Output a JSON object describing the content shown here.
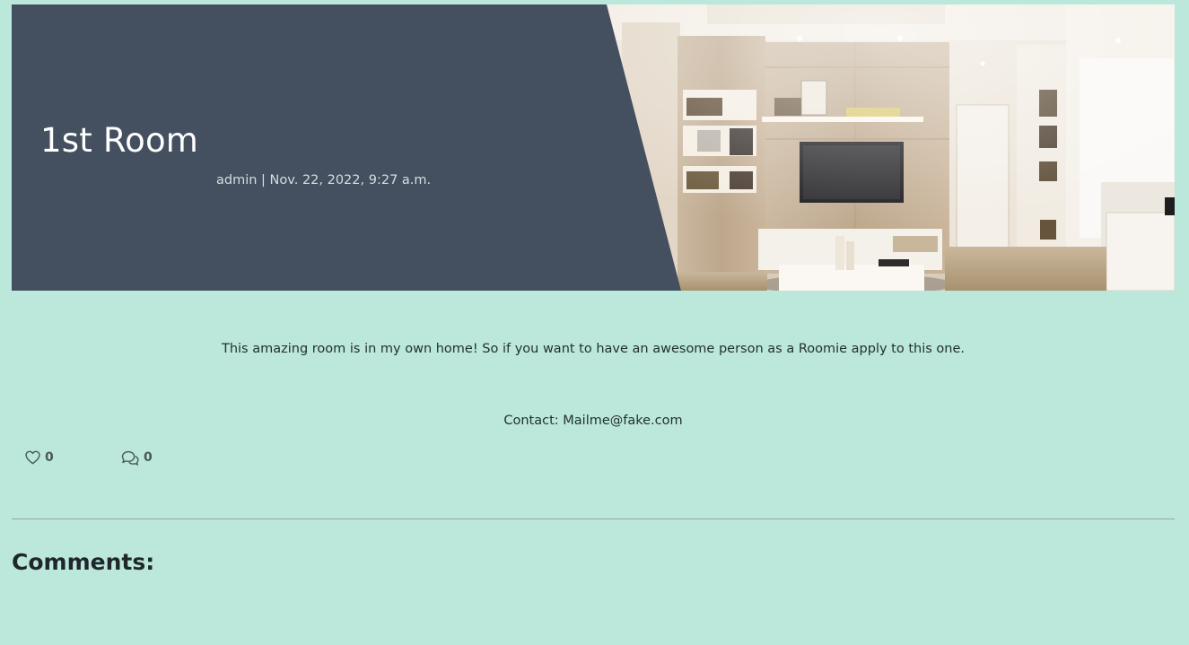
{
  "post": {
    "title": "1st Room",
    "author": "admin",
    "date": "Nov. 22, 2022, 9:27 a.m.",
    "description": "This amazing room is in my own home! So if you want to have an awesome person as a Roomie apply to this one.",
    "contact_label": "Contact:",
    "contact_email": "Mailme@fake.com"
  },
  "reactions": {
    "likes": "0",
    "comments": "0",
    "like_icon": "heart-outline-icon",
    "comment_icon": "chat-bubbles-icon"
  },
  "comments": {
    "heading": "Comments:"
  },
  "colors": {
    "page_background": "#bbe8db",
    "hero_panel": "#44505f",
    "title_text": "#ffffff",
    "meta_text": "#d6dde3",
    "body_text": "#24302f"
  }
}
